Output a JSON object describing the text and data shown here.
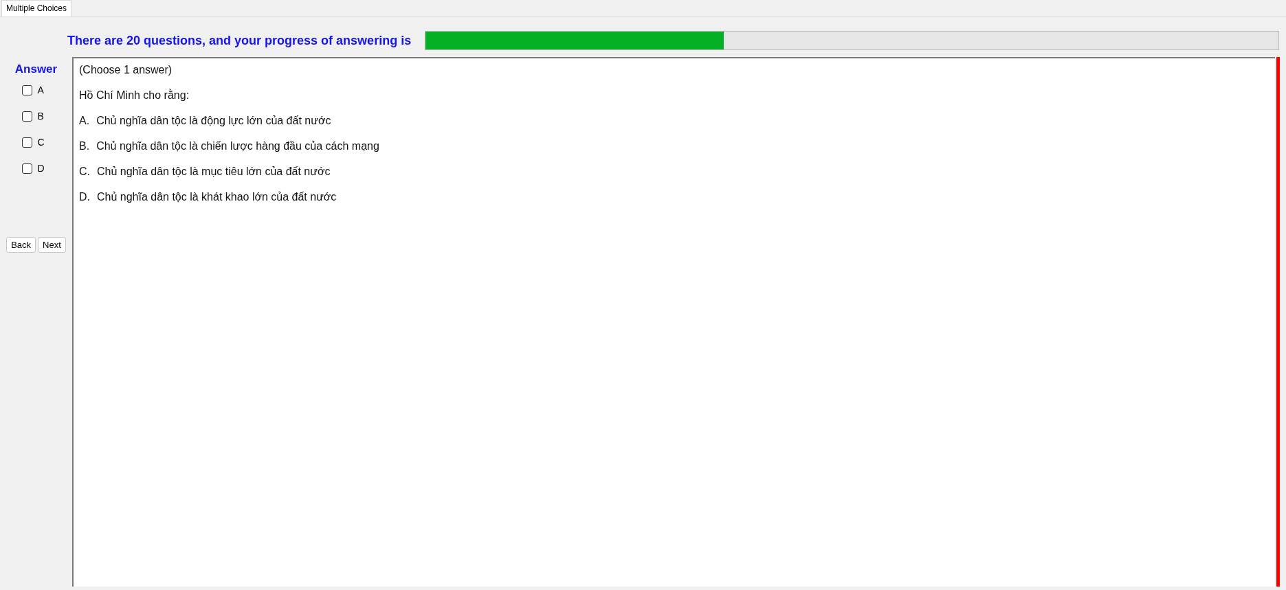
{
  "tabs": [
    {
      "label": "Multiple Choices",
      "selected": true
    }
  ],
  "header": {
    "text": "There are 20 questions, and your progress of answering is",
    "progress": {
      "level": 0.35
    }
  },
  "answer_panel": {
    "title": "Answer",
    "options": [
      {
        "label": "A",
        "checked": false
      },
      {
        "label": "B",
        "checked": false
      },
      {
        "label": "C",
        "checked": false
      },
      {
        "label": "D",
        "checked": false
      }
    ],
    "buttons": [
      "Back",
      "Next"
    ]
  },
  "question": {
    "instruction": "(Choose 1 answer)",
    "prompt": "Hồ Chí Minh cho rằng:",
    "choices": [
      {
        "letter": "A.",
        "text": "Chủ nghĩa dân tộc là động lực lớn của đất nước"
      },
      {
        "letter": "B.",
        "text": "Chủ nghĩa dân tộc là chiến lược hàng đầu của cách mạng"
      },
      {
        "letter": "C.",
        "text": "Chủ nghĩa dân tộc là mục tiêu lớn của đất nước"
      },
      {
        "letter": "D.",
        "text": "Chủ nghĩa dân tộc là khát khao lớn của đất nước"
      }
    ]
  }
}
